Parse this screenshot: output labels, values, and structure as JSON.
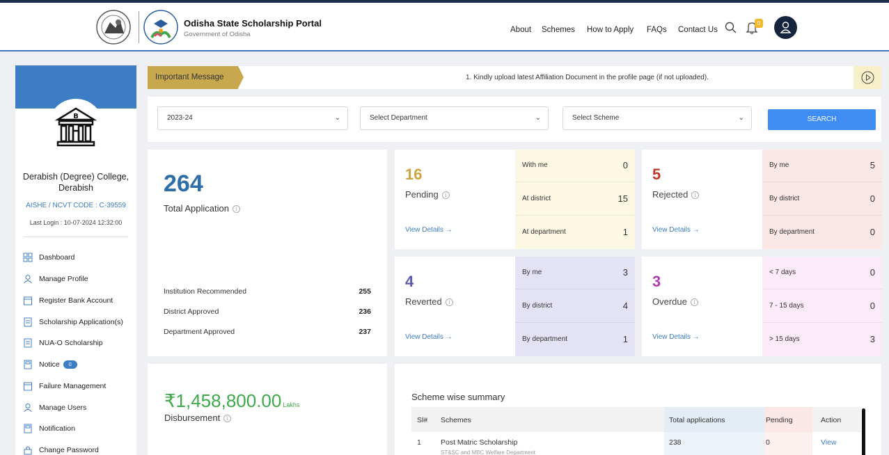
{
  "header": {
    "portal_title": "Odisha State Scholarship Portal",
    "portal_subtitle": "Government of Odisha",
    "nav": [
      "About",
      "Schemes",
      "How to Apply",
      "FAQs",
      "Contact Us"
    ],
    "notification_count": "0",
    "icons": [
      "search-icon",
      "bell-icon",
      "user-icon"
    ]
  },
  "sidebar": {
    "college_name": "Derabish (Degree) College, Derabish",
    "aishe_code": "AISHE / NCVT CODE : C-39559",
    "last_login": "Last Login : 10-07-2024 12:32:00",
    "menu": [
      {
        "label": "Dashboard",
        "icon": "grid-icon"
      },
      {
        "label": "Manage Profile",
        "icon": "user-icon"
      },
      {
        "label": "Register Bank Account",
        "icon": "calendar-icon"
      },
      {
        "label": "Scholarship Application(s)",
        "icon": "document-icon"
      },
      {
        "label": "NUA-O Scholarship",
        "icon": "document-icon"
      },
      {
        "label": "Notice",
        "icon": "notice-icon",
        "badge": "0"
      },
      {
        "label": "Failure Management",
        "icon": "calendar-icon"
      },
      {
        "label": "Manage Users",
        "icon": "user-icon"
      },
      {
        "label": "Notification",
        "icon": "notice-icon"
      },
      {
        "label": "Change Password",
        "icon": "lock-icon"
      }
    ]
  },
  "message": {
    "tag": "Important Message",
    "text": "1.  Kindly upload latest Affiliation Document in the profile page (if not uploaded)."
  },
  "filters": {
    "year": "2023-24",
    "department": "Select Department",
    "scheme": "Select Scheme",
    "search_label": "SEARCH"
  },
  "total": {
    "value": "264",
    "label": "Total Application",
    "rows": [
      {
        "label": "Institution Recommended",
        "value": "255"
      },
      {
        "label": "District Approved",
        "value": "236"
      },
      {
        "label": "Department Approved",
        "value": "237"
      }
    ]
  },
  "status_cards": [
    {
      "value": "16",
      "label": "Pending",
      "color": "#c9a43f",
      "bg": "#fdf8e3",
      "rows": [
        {
          "k": "With me",
          "v": "0"
        },
        {
          "k": "At district",
          "v": "15"
        },
        {
          "k": "At department",
          "v": "1"
        }
      ]
    },
    {
      "value": "5",
      "label": "Rejected",
      "color": "#c0392b",
      "bg": "#fbe7e6",
      "rows": [
        {
          "k": "By me",
          "v": "5"
        },
        {
          "k": "By district",
          "v": "0"
        },
        {
          "k": "By department",
          "v": "0"
        }
      ]
    },
    {
      "value": "4",
      "label": "Reverted",
      "color": "#5b5bab",
      "bg": "#e4e3f6",
      "rows": [
        {
          "k": "By me",
          "v": "3"
        },
        {
          "k": "By district",
          "v": "4"
        },
        {
          "k": "By department",
          "v": "1"
        }
      ]
    },
    {
      "value": "3",
      "label": "Overdue",
      "color": "#b23bb5",
      "bg": "#fbeaf8",
      "rows": [
        {
          "k": "< 7 days",
          "v": "0"
        },
        {
          "k": "7 - 15 days",
          "v": "0"
        },
        {
          "k": "> 15 days",
          "v": "3"
        }
      ]
    }
  ],
  "view_details": "View Details →",
  "disbursement": {
    "amount": "₹1,458,800.00",
    "unit": "Lakhs",
    "label": "Disbursement"
  },
  "scheme_summary": {
    "title": "Scheme wise summary",
    "headers": [
      "Sl#",
      "Schemes",
      "Total applications",
      "Pending",
      "Action"
    ],
    "rows": [
      {
        "sl": "1",
        "scheme": "Post Matric Scholarship",
        "dept": "ST&SC and MBC Welfare Department",
        "total": "238",
        "pending": "0",
        "action": "View"
      }
    ]
  }
}
